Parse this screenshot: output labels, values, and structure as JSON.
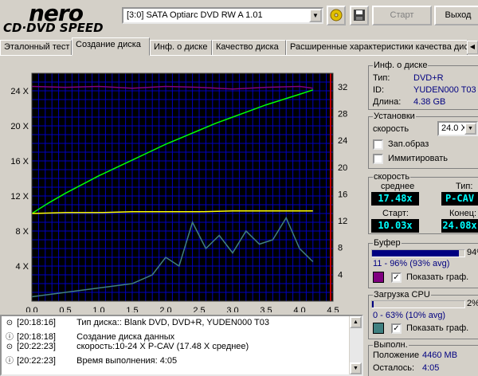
{
  "header": {
    "logo_main": "nero",
    "logo_sub": "CD·DVD SPEED",
    "drive": "[3:0]  SATA Optiarc DVD RW A 1.01",
    "start_label": "Старт",
    "exit_label": "Выход"
  },
  "tabs": [
    {
      "label": "Эталонный тест"
    },
    {
      "label": "Создание диска"
    },
    {
      "label": "Инф. о диске"
    },
    {
      "label": "Качество диска"
    },
    {
      "label": "Расширенные характеристики качества дис"
    }
  ],
  "disc_info": {
    "title": "Инф. о диске",
    "type_label": "Тип:",
    "type_value": "DVD+R",
    "id_label": "ID:",
    "id_value": "YUDEN000 T03",
    "length_label": "Длина:",
    "length_value": "4.38 GB"
  },
  "settings": {
    "title": "Установки",
    "speed_label": "скорость",
    "speed_value": "24.0 X",
    "image_label": "Зап.образ",
    "image_checked": false,
    "simulate_label": "Иммитировать",
    "simulate_checked": false
  },
  "speed": {
    "title": "скорость",
    "avg_label": "среднее",
    "avg_value": "17.48x",
    "type_label": "Тип:",
    "type_value": "P-CAV",
    "start_label": "Старт:",
    "start_value": "10.03x",
    "end_label": "Конец:",
    "end_value": "24.08x"
  },
  "buffer": {
    "title": "Буфер",
    "percent": 94,
    "percent_label": "94%",
    "range": "11 - 96% (93% avg)",
    "show_label": "Показать граф.",
    "show_checked": true,
    "color": "#800080"
  },
  "cpu": {
    "title": "Загрузка CPU",
    "percent": 2,
    "percent_label": "2%",
    "range": "0 - 63% (10% avg)",
    "show_label": "Показать граф.",
    "show_checked": true,
    "color": "#408080"
  },
  "progress": {
    "title": "Выполн.",
    "position_label": "Положение",
    "position_value": "4460 MB",
    "remain_label": "Осталось:",
    "remain_value": "4:05"
  },
  "log": [
    {
      "time": "[20:18:16]",
      "msg": "Тип диска:: Blank DVD, DVD+R, YUDEN000 T03",
      "icon": "disc-icon"
    },
    {
      "time": "[20:18:18]",
      "msg": "Создание диска данных",
      "icon": "info-icon"
    },
    {
      "time": "[20:22:23]",
      "msg": "скорость:10-24 X P-CAV (17.48 X среднее)",
      "icon": "disc-icon"
    },
    {
      "time": "[20:22:23]",
      "msg": "Время выполнения: 4:05",
      "icon": "info-icon"
    }
  ],
  "chart_data": {
    "type": "line",
    "x_ticks": [
      "0.0",
      "0.5",
      "1.0",
      "1.5",
      "2.0",
      "2.5",
      "3.0",
      "3.5",
      "4.0",
      "4.5"
    ],
    "y_left_ticks": [
      "4 X",
      "8 X",
      "12 X",
      "16 X",
      "20 X",
      "24 X"
    ],
    "y_right_ticks": [
      "4",
      "8",
      "12",
      "16",
      "20",
      "24",
      "28",
      "32"
    ],
    "xlim": [
      0,
      4.5
    ],
    "ylim_left": [
      0,
      26
    ],
    "ylim_right": [
      0,
      34
    ],
    "series": [
      {
        "color": "#00ff00",
        "x": [
          0,
          0.25,
          0.5,
          0.75,
          1.0,
          1.25,
          1.5,
          1.75,
          2.0,
          2.25,
          2.5,
          2.75,
          3.0,
          3.25,
          3.5,
          3.75,
          4.0,
          4.2
        ],
        "y": [
          10.0,
          11.2,
          12.3,
          13.3,
          14.3,
          15.2,
          16.1,
          17.0,
          17.9,
          18.7,
          19.5,
          20.3,
          21.0,
          21.7,
          22.4,
          23.0,
          23.6,
          24.1
        ]
      },
      {
        "color": "#ffff00",
        "x": [
          0,
          0.5,
          1.0,
          1.5,
          2.0,
          2.5,
          3.0,
          3.5,
          4.0,
          4.2
        ],
        "y": [
          10.0,
          10.1,
          10.1,
          10.2,
          10.2,
          10.2,
          10.3,
          10.3,
          10.3,
          10.3
        ]
      },
      {
        "color": "#800080",
        "x": [
          0,
          0.5,
          1.0,
          1.5,
          2.0,
          2.5,
          3.0,
          3.5,
          4.0,
          4.2
        ],
        "y": [
          24.5,
          24.4,
          24.5,
          24.3,
          24.5,
          24.4,
          24.2,
          24.4,
          24.5,
          24.3
        ]
      },
      {
        "color": "#408080",
        "x": [
          0,
          0.5,
          1.0,
          1.5,
          1.8,
          2.0,
          2.2,
          2.4,
          2.6,
          2.8,
          3.0,
          3.2,
          3.4,
          3.6,
          3.8,
          4.0,
          4.2
        ],
        "y": [
          0.5,
          1.0,
          1.5,
          2.0,
          3.0,
          5.0,
          4.0,
          9.0,
          6.0,
          7.5,
          5.5,
          8.0,
          6.5,
          7.0,
          9.5,
          6.0,
          4.5
        ]
      }
    ]
  }
}
